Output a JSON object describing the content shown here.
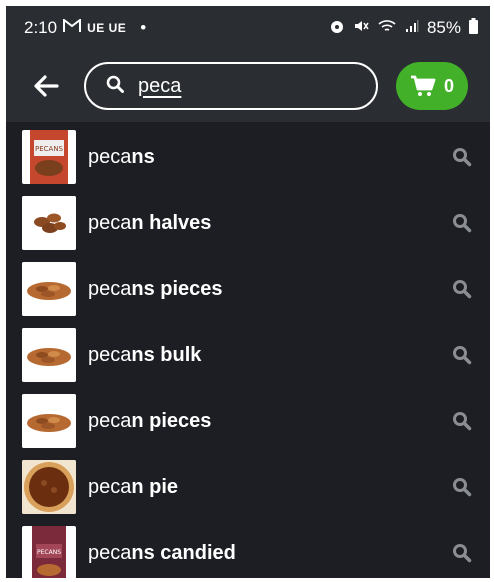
{
  "status": {
    "time": "2:10",
    "carriers": "UE UE",
    "dot": "•",
    "battery": "85%"
  },
  "header": {
    "search_value": "peca",
    "cart_count": "0"
  },
  "suggestions": [
    {
      "prefix": "peca",
      "rest": "ns",
      "image": "pecans-bag"
    },
    {
      "prefix": "peca",
      "rest": "n halves",
      "image": "pecan-halves"
    },
    {
      "prefix": "peca",
      "rest": "ns pieces",
      "image": "pecan-pile"
    },
    {
      "prefix": "peca",
      "rest": "ns bulk",
      "image": "pecan-pile"
    },
    {
      "prefix": "peca",
      "rest": "n pieces",
      "image": "pecan-pile"
    },
    {
      "prefix": "peca",
      "rest": "n pie",
      "image": "pecan-pie"
    },
    {
      "prefix": "peca",
      "rest": "ns candied",
      "image": "candied-bag"
    }
  ],
  "colors": {
    "background": "#1c1e23",
    "header": "#2a2d32",
    "cart_green": "#43b02a",
    "muted_icon": "#8a8d91"
  }
}
